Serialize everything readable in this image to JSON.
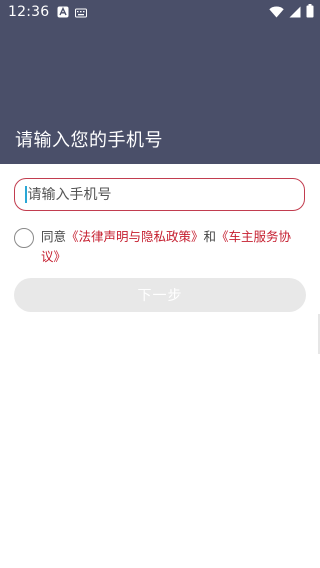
{
  "status_bar": {
    "time": "12:36",
    "left_icons": [
      "a-icon",
      "keyboard-icon"
    ],
    "right_icons": [
      "wifi-icon",
      "signal-icon",
      "battery-icon"
    ]
  },
  "header": {
    "title": "请输入您的手机号",
    "background_color": "#4a4f69"
  },
  "phone_input": {
    "placeholder": "请输入手机号",
    "value": "",
    "border_color": "#c23d4f"
  },
  "agreement": {
    "prefix": "同意",
    "link1": "《法律声明与隐私政策》",
    "middle": "和",
    "link2": "《车主服务协议》",
    "checked": false,
    "link_color": "#c51e2f"
  },
  "next_button": {
    "label": "下一步",
    "enabled": false
  }
}
